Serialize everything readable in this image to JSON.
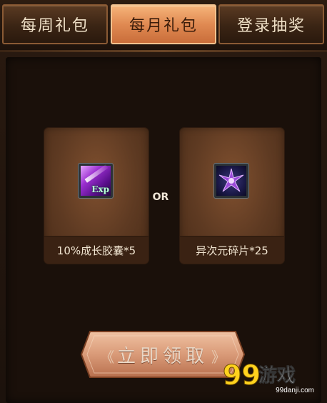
{
  "tabs": [
    {
      "label": "每周礼包",
      "active": false
    },
    {
      "label": "每月礼包",
      "active": true
    },
    {
      "label": "登录抽奖",
      "active": false
    }
  ],
  "rewards": [
    {
      "label": "10%成长胶囊*5",
      "icon": "exp-capsule-icon",
      "icon_text": "Exp"
    },
    {
      "label": "异次元碎片*25",
      "icon": "dimension-shard-icon"
    }
  ],
  "or_text": "OR",
  "claim_button": {
    "label": "立即领取",
    "left_deco": "《",
    "right_deco": "》"
  },
  "watermark": {
    "text": "99游戏",
    "sub": "99danji.com"
  },
  "colors": {
    "active_tab": "#e08a52",
    "inactive_tab": "#3a2414",
    "card": "#5e3a22",
    "button": "#e2a98a"
  }
}
